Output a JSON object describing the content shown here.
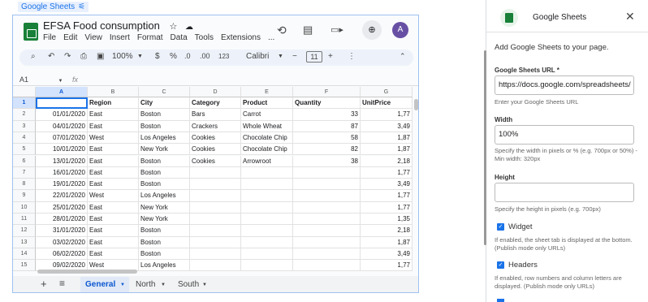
{
  "block_tag": {
    "label": "Google Sheets"
  },
  "sheet": {
    "title": "EFSA Food consumption",
    "menu": [
      "File",
      "Edit",
      "View",
      "Insert",
      "Format",
      "Data",
      "Tools",
      "Extensions",
      "..."
    ],
    "avatar": "A",
    "toolbar": {
      "zoom": "100%",
      "currency": "$",
      "percent": "%",
      "dec_dec": ".0",
      "inc_dec": ".00",
      "number_format": "123",
      "font": "Calibri",
      "font_size": "11"
    },
    "name_box": "A1",
    "fx": "fx",
    "columns": [
      "A",
      "B",
      "C",
      "D",
      "E",
      "F",
      "G"
    ],
    "rows": [
      {
        "n": "1",
        "a": "",
        "b": "Region",
        "c": "City",
        "d": "Category",
        "e": "Product",
        "f": "Quantity",
        "g": "UnitPrice"
      },
      {
        "n": "2",
        "a": "01/01/2020",
        "b": "East",
        "c": "Boston",
        "d": "Bars",
        "e": "Carrot",
        "f": "33",
        "g": "1,77"
      },
      {
        "n": "3",
        "a": "04/01/2020",
        "b": "East",
        "c": "Boston",
        "d": "Crackers",
        "e": "Whole Wheat",
        "f": "87",
        "g": "3,49"
      },
      {
        "n": "4",
        "a": "07/01/2020",
        "b": "West",
        "c": "Los Angeles",
        "d": "Cookies",
        "e": "Chocolate Chip",
        "f": "58",
        "g": "1,87"
      },
      {
        "n": "5",
        "a": "10/01/2020",
        "b": "East",
        "c": "New York",
        "d": "Cookies",
        "e": "Chocolate Chip",
        "f": "82",
        "g": "1,87"
      },
      {
        "n": "6",
        "a": "13/01/2020",
        "b": "East",
        "c": "Boston",
        "d": "Cookies",
        "e": "Arrowroot",
        "f": "38",
        "g": "2,18"
      },
      {
        "n": "7",
        "a": "16/01/2020",
        "b": "East",
        "c": "Boston",
        "d": "",
        "e": "",
        "f": "",
        "g": "1,77"
      },
      {
        "n": "8",
        "a": "19/01/2020",
        "b": "East",
        "c": "Boston",
        "d": "",
        "e": "",
        "f": "",
        "g": "3,49"
      },
      {
        "n": "9",
        "a": "22/01/2020",
        "b": "West",
        "c": "Los Angeles",
        "d": "",
        "e": "",
        "f": "",
        "g": "1,77"
      },
      {
        "n": "10",
        "a": "25/01/2020",
        "b": "East",
        "c": "New York",
        "d": "",
        "e": "",
        "f": "",
        "g": "1,77"
      },
      {
        "n": "11",
        "a": "28/01/2020",
        "b": "East",
        "c": "New York",
        "d": "",
        "e": "",
        "f": "",
        "g": "1,35"
      },
      {
        "n": "12",
        "a": "31/01/2020",
        "b": "East",
        "c": "Boston",
        "d": "",
        "e": "",
        "f": "",
        "g": "2,18"
      },
      {
        "n": "13",
        "a": "03/02/2020",
        "b": "East",
        "c": "Boston",
        "d": "",
        "e": "",
        "f": "",
        "g": "1,87"
      },
      {
        "n": "14",
        "a": "06/02/2020",
        "b": "East",
        "c": "Boston",
        "d": "",
        "e": "",
        "f": "",
        "g": "3,49"
      },
      {
        "n": "15",
        "a": "09/02/2020",
        "b": "West",
        "c": "Los Angeles",
        "d": "",
        "e": "",
        "f": "",
        "g": "1,77"
      }
    ],
    "tabs": [
      "General",
      "North",
      "South"
    ]
  },
  "panel": {
    "title": "Google Sheets",
    "intro": "Add Google Sheets to your page.",
    "url_label": "Google Sheets URL *",
    "url_value": "https://docs.google.com/spreadsheets/",
    "url_help": "Enter your Google Sheets URL",
    "width_label": "Width",
    "width_value": "100%",
    "width_help": "Specify the width in pixels or % (e.g. 700px or 50%) - Min width: 320px",
    "height_label": "Height",
    "height_value": "",
    "height_help": "Specify the height in pixels (e.g. 700px)",
    "widget_label": "Widget",
    "widget_help": "If enabled, the sheet tab is displayed at the bottom. (Publish mode only URLs)",
    "headers_label": "Headers",
    "headers_help": "If enabled, row numbers and column letters are displayed. (Publish mode only URLs)"
  },
  "colors": {
    "accent": "#1a73e8",
    "sheets_green": "#188038",
    "selection": "#1a73e8"
  }
}
